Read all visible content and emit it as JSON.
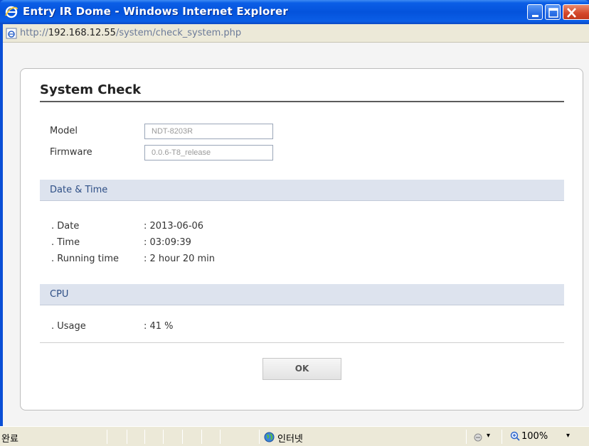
{
  "window": {
    "title": "Entry IR Dome - Windows Internet Explorer",
    "address_prefix": "http://",
    "address_host": "192.168.12.55",
    "address_path": "/system/check_system.php"
  },
  "page": {
    "title": "System Check",
    "model_label": "Model",
    "model_value": "NDT-8203R",
    "firmware_label": "Firmware",
    "firmware_value": "0.0.6-T8_release",
    "datetime_section": {
      "title": "Date & Time",
      "rows": [
        {
          "key": ". Date",
          "value": ": 2013-06-06"
        },
        {
          "key": ". Time",
          "value": ": 03:09:39"
        },
        {
          "key": ". Running time",
          "value": ": 2 hour 20 min"
        }
      ]
    },
    "cpu_section": {
      "title": "CPU",
      "rows": [
        {
          "key": ". Usage",
          "value": ": 41 %"
        }
      ]
    },
    "ok_label": "OK"
  },
  "statusbar": {
    "status_text": "완료",
    "zone_text": "인터넷",
    "zoom_text": "100%",
    "caret": "▾"
  },
  "colors": {
    "titlebar": "#0453dc",
    "section_bar": "#dde3ee",
    "section_text": "#2e4f86"
  }
}
